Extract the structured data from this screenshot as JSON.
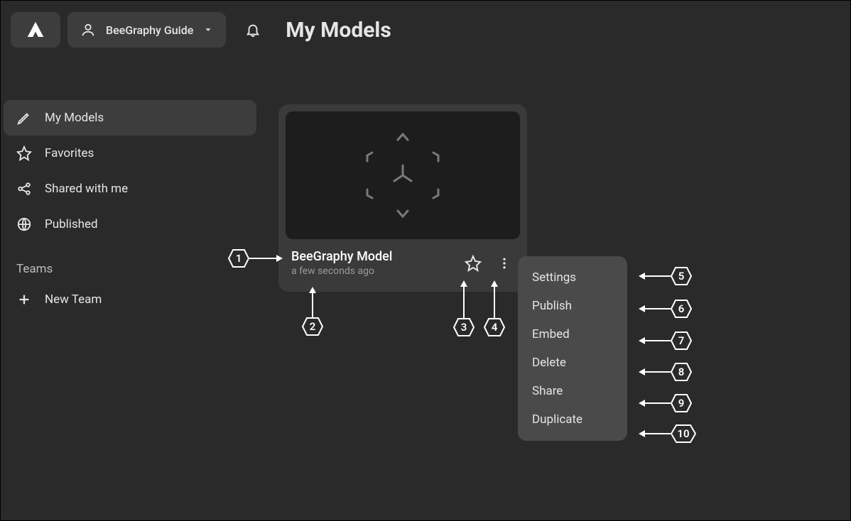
{
  "header": {
    "account_name": "BeeGraphy Guide",
    "page_title": "My Models"
  },
  "sidebar": {
    "items": [
      {
        "label": "My Models",
        "icon": "pencil-icon"
      },
      {
        "label": "Favorites",
        "icon": "star-icon"
      },
      {
        "label": "Shared with me",
        "icon": "share-icon"
      },
      {
        "label": "Published",
        "icon": "globe-icon"
      }
    ],
    "teams_label": "Teams",
    "new_team_label": "New Team"
  },
  "card": {
    "title": "BeeGraphy Model",
    "timestamp": "a few seconds ago"
  },
  "context_menu": {
    "items": [
      {
        "label": "Settings"
      },
      {
        "label": "Publish"
      },
      {
        "label": "Embed"
      },
      {
        "label": "Delete"
      },
      {
        "label": "Share"
      },
      {
        "label": "Duplicate"
      }
    ]
  },
  "annotations": {
    "b1": "1",
    "b2": "2",
    "b3": "3",
    "b4": "4",
    "b5": "5",
    "b6": "6",
    "b7": "7",
    "b8": "8",
    "b9": "9",
    "b10": "10"
  }
}
